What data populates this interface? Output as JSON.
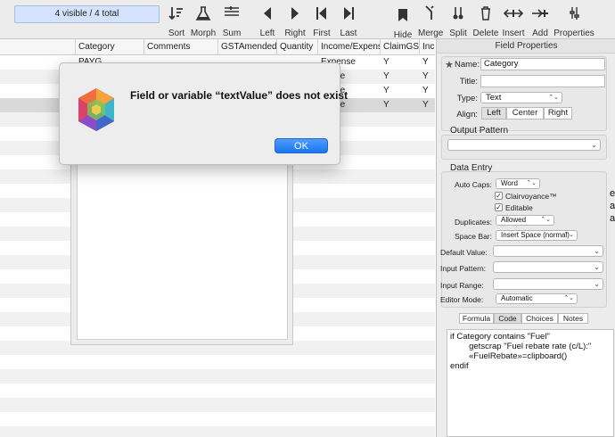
{
  "toolbar": {
    "record_count": "4 visible / 4 total",
    "buttons": [
      {
        "label": "Sort",
        "icon": "sort-icon"
      },
      {
        "label": "Morph",
        "icon": "flask-icon"
      },
      {
        "label": "Sum",
        "icon": "sum-icon"
      },
      {
        "label": "Left",
        "icon": "arrow-left-icon"
      },
      {
        "label": "Right",
        "icon": "arrow-right-icon"
      },
      {
        "label": "First",
        "icon": "first-icon"
      },
      {
        "label": "Last",
        "icon": "last-icon"
      },
      {
        "label": "Hide",
        "icon": "hide-icon"
      },
      {
        "label": "Merge",
        "icon": "merge-icon"
      },
      {
        "label": "Split",
        "icon": "split-icon"
      },
      {
        "label": "Delete",
        "icon": "delete-icon"
      },
      {
        "label": "Insert",
        "icon": "insert-icon"
      },
      {
        "label": "Add",
        "icon": "add-icon"
      },
      {
        "label": "Properties",
        "icon": "properties-icon"
      }
    ]
  },
  "table": {
    "columns": [
      "Category",
      "Comments",
      "GSTAmended",
      "Quantity",
      "Income/Expense",
      "ClaimGST",
      "Incl"
    ],
    "rows": [
      [
        "PAYG",
        "",
        "",
        "",
        "Expense",
        "Y",
        "Y"
      ],
      [
        "",
        "",
        "",
        "",
        "pense",
        "Y",
        "Y"
      ],
      [
        "",
        "",
        "",
        "",
        "pense",
        "Y",
        "Y"
      ],
      [
        "",
        "",
        "",
        "",
        "pense",
        "Y",
        "Y"
      ]
    ]
  },
  "alert": {
    "message": "Field or variable “textValue” does not exist",
    "ok_label": "OK"
  },
  "panel": {
    "title": "Field Properties",
    "name_label": "Name:",
    "name_value": "Category",
    "title_label": "Title:",
    "title_value": "",
    "type_label": "Type:",
    "type_value": "Text",
    "align_label": "Align:",
    "align_options": [
      "Left",
      "Center",
      "Right"
    ],
    "align_selected": "Left",
    "output_pattern_title": "Output Pattern",
    "data_entry_title": "Data Entry",
    "auto_caps_label": "Auto Caps:",
    "auto_caps_value": "Word",
    "clairvoyance_label": "Clairvoyance™",
    "editable_label": "Editable",
    "duplicates_label": "Duplicates:",
    "duplicates_value": "Allowed",
    "space_bar_label": "Space Bar:",
    "space_bar_value": "Insert Space (normal)",
    "default_value_label": "Default Value:",
    "input_pattern_label": "Input Pattern:",
    "input_range_label": "Input Range:",
    "editor_mode_label": "Editor Mode:",
    "editor_mode_value": "Automatic",
    "tabs": [
      "Formula",
      "Code",
      "Choices",
      "Notes"
    ],
    "selected_tab": "Code",
    "code_lines": [
      "if Category contains \"Fuel\"",
      "        getscrap \"Fuel rebate rate (c/L):\"",
      "        «FuelRebate»=clipboard()",
      "endif"
    ]
  },
  "edge_fragments": [
    "e",
    "a",
    "a"
  ]
}
